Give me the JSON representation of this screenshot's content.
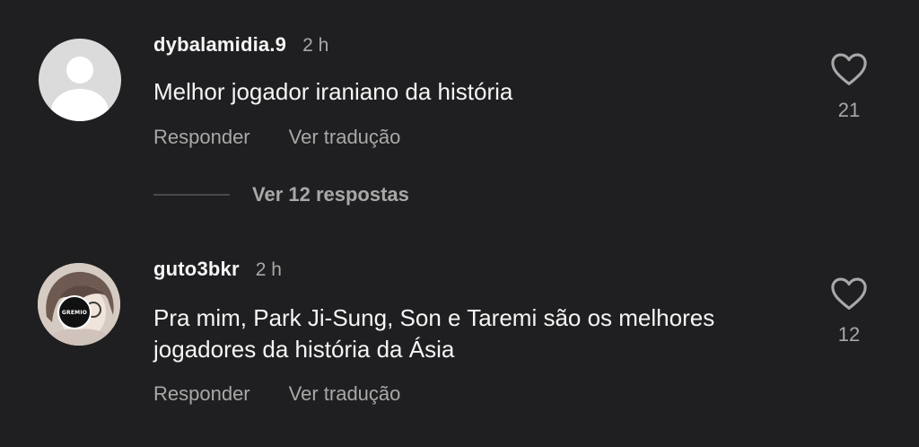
{
  "comments": [
    {
      "username": "dybalamidia.9",
      "time": "2 h",
      "text": "Melhor jogador iraniano da história",
      "reply_label": "Responder",
      "translate_label": "Ver tradução",
      "likes": "21",
      "avatar": "default-avatar"
    },
    {
      "username": "guto3bkr",
      "time": "2 h",
      "text": "Pra mim, Park Ji-Sung, Son e Taremi são os melhores jogadores da história da Ásia",
      "reply_label": "Responder",
      "translate_label": "Ver tradução",
      "likes": "12",
      "avatar": "photo-avatar",
      "avatar_badge": "GREMIO"
    }
  ],
  "view_replies_label": "Ver 12 respostas",
  "colors": {
    "background": "#1f1f21",
    "primary_text": "#f5f5f5",
    "secondary_text": "#a8a8a8",
    "default_avatar": "#dbdbdb"
  },
  "icons": {
    "like": "heart-outline-icon",
    "default_avatar": "user-silhouette-icon"
  }
}
